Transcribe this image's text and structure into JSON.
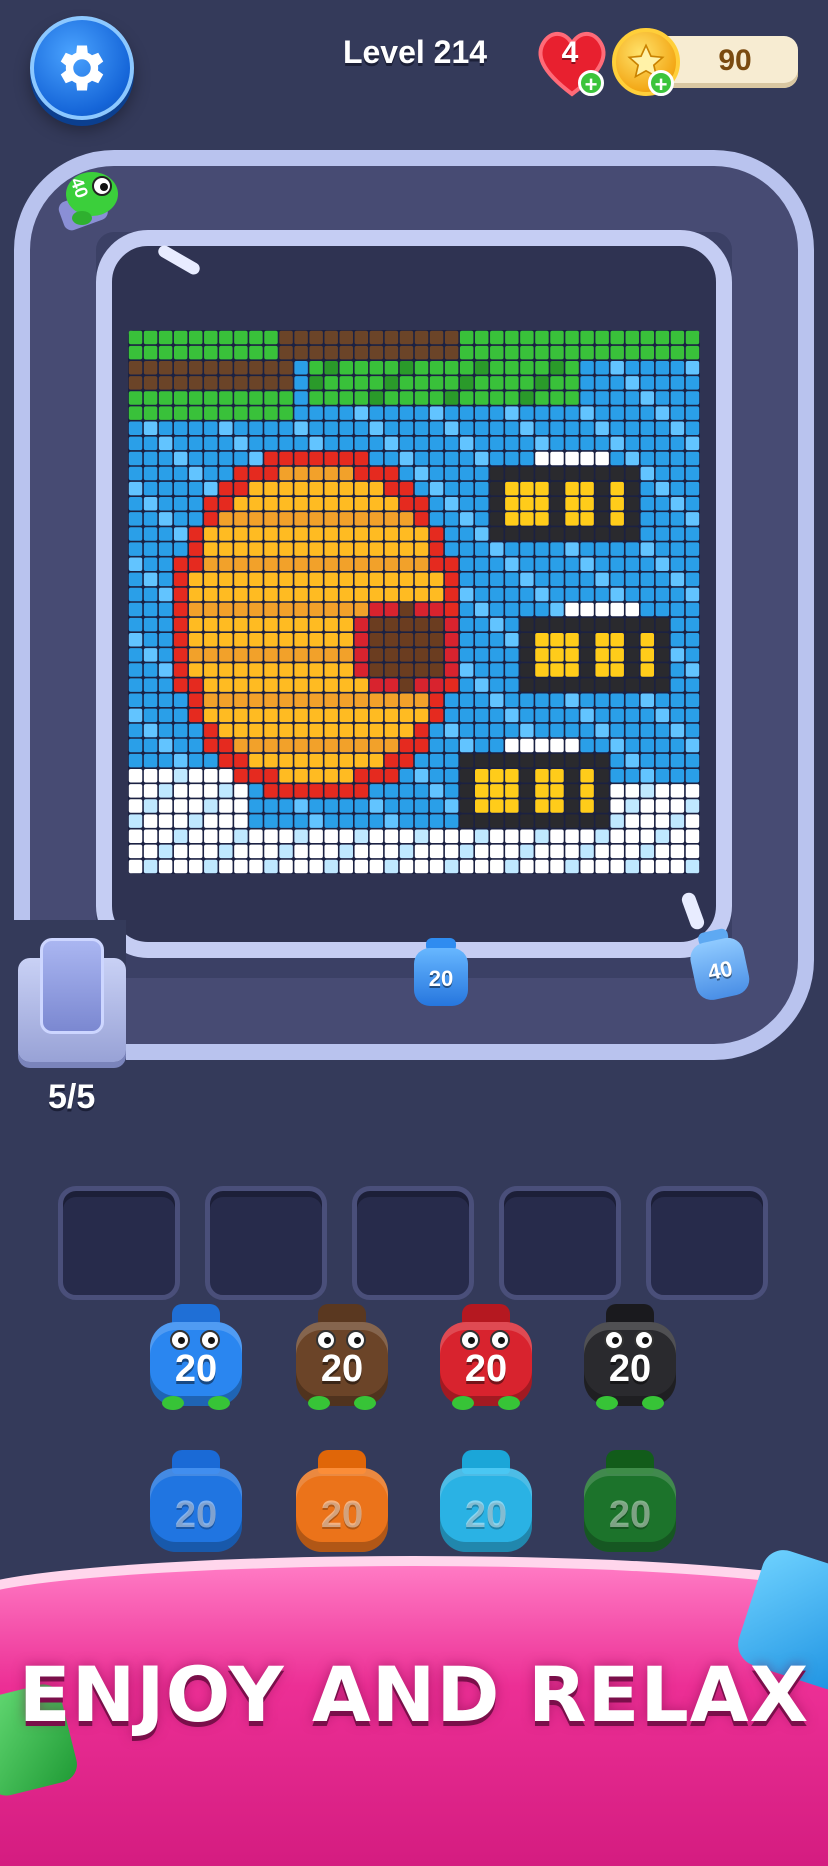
{
  "header": {
    "level_label": "Level 214",
    "lives": "4",
    "coins": "90",
    "icons": [
      "gear-icon",
      "heart-icon",
      "plus-icon",
      "star-coin-icon"
    ]
  },
  "track": {
    "queue_count": "5/5",
    "track_jar_label": "20",
    "shooter_right_label": "40",
    "shooter_left_label": "40"
  },
  "slots": {
    "empty_count": 5
  },
  "jars": {
    "row1": [
      {
        "label": "20",
        "color": "#2a86f0",
        "cap": "#1f6fd6"
      },
      {
        "label": "20",
        "color": "#6b4428",
        "cap": "#5a3820"
      },
      {
        "label": "20",
        "color": "#d8232e",
        "cap": "#b51820"
      },
      {
        "label": "20",
        "color": "#2a2a2e",
        "cap": "#1a1a1e"
      }
    ],
    "row2": [
      {
        "label": "20",
        "color": "#1e7cf0",
        "cap": "#1a6ad6"
      },
      {
        "label": "20",
        "color": "#ff7a14",
        "cap": "#e06608"
      },
      {
        "label": "20",
        "color": "#2ac0f4",
        "cap": "#1ba6d8"
      },
      {
        "label": "20",
        "color": "#1a7a26",
        "cap": "#125c1a"
      }
    ]
  },
  "banner": {
    "text": "ENJOY AND RELAX"
  },
  "colors": {
    "background": "#343a5a",
    "track": "#b9c3ee",
    "banner": "#ec2f95"
  }
}
